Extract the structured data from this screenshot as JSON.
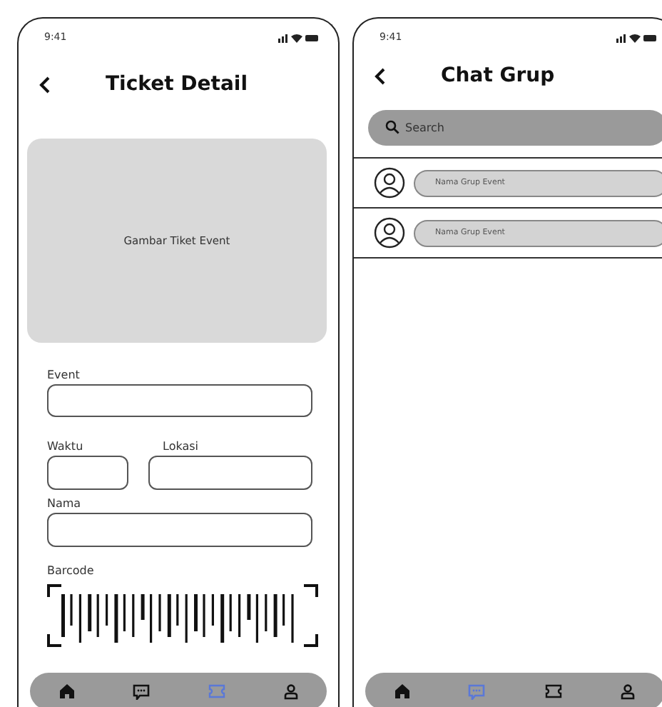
{
  "ticket_screen": {
    "status_time": "9:41",
    "title": "Ticket Detail",
    "image_label": "Gambar Tiket Event",
    "fields": [
      {
        "label": "Event"
      },
      {
        "label": "Waktu"
      },
      {
        "label": "Lokasi"
      },
      {
        "label": "Nama"
      }
    ],
    "barcode_label": "Barcode",
    "nav": [
      {
        "kind": "home",
        "selected": false
      },
      {
        "kind": "chat",
        "selected": false
      },
      {
        "kind": "ticket",
        "selected": true
      },
      {
        "kind": "profile",
        "selected": false
      }
    ]
  },
  "chat_screen": {
    "status_time": "9:41",
    "title": "Chat Grup",
    "search": {
      "placeholder": "Search"
    },
    "groups": [
      {
        "name": "Nama Grup Event"
      },
      {
        "name": "Nama Grup Event"
      }
    ],
    "nav": [
      {
        "kind": "home",
        "selected": false
      },
      {
        "kind": "chat",
        "selected": true
      },
      {
        "kind": "ticket",
        "selected": false
      },
      {
        "kind": "profile",
        "selected": false
      }
    ]
  }
}
